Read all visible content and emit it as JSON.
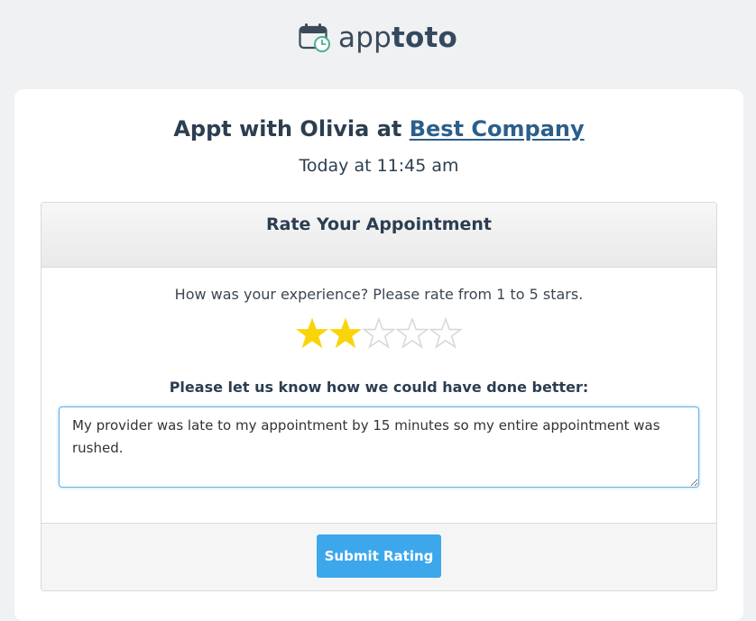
{
  "brand": {
    "name_light": "app",
    "name_bold": "toto",
    "icon": "calendar-clock-icon"
  },
  "appointment": {
    "title_prefix": "Appt with Olivia at ",
    "company": "Best Company",
    "time": "Today at 11:45 am"
  },
  "rating_panel": {
    "title": "Rate Your Appointment",
    "prompt": "How was your experience? Please rate from 1 to 5 stars.",
    "rating": 2,
    "max_rating": 5,
    "filled_color": "#f9d40a",
    "empty_color": "#d8d8d8",
    "feedback_label": "Please let us know how we could have done better:",
    "feedback_value": "My provider was late to my appointment by 15 minutes so my entire appointment was rushed.",
    "submit_label": "Submit Rating"
  },
  "colors": {
    "background": "#eff1f3",
    "card": "#ffffff",
    "text": "#2c3e50",
    "link": "#2c5f8a",
    "button": "#3da7ec"
  }
}
